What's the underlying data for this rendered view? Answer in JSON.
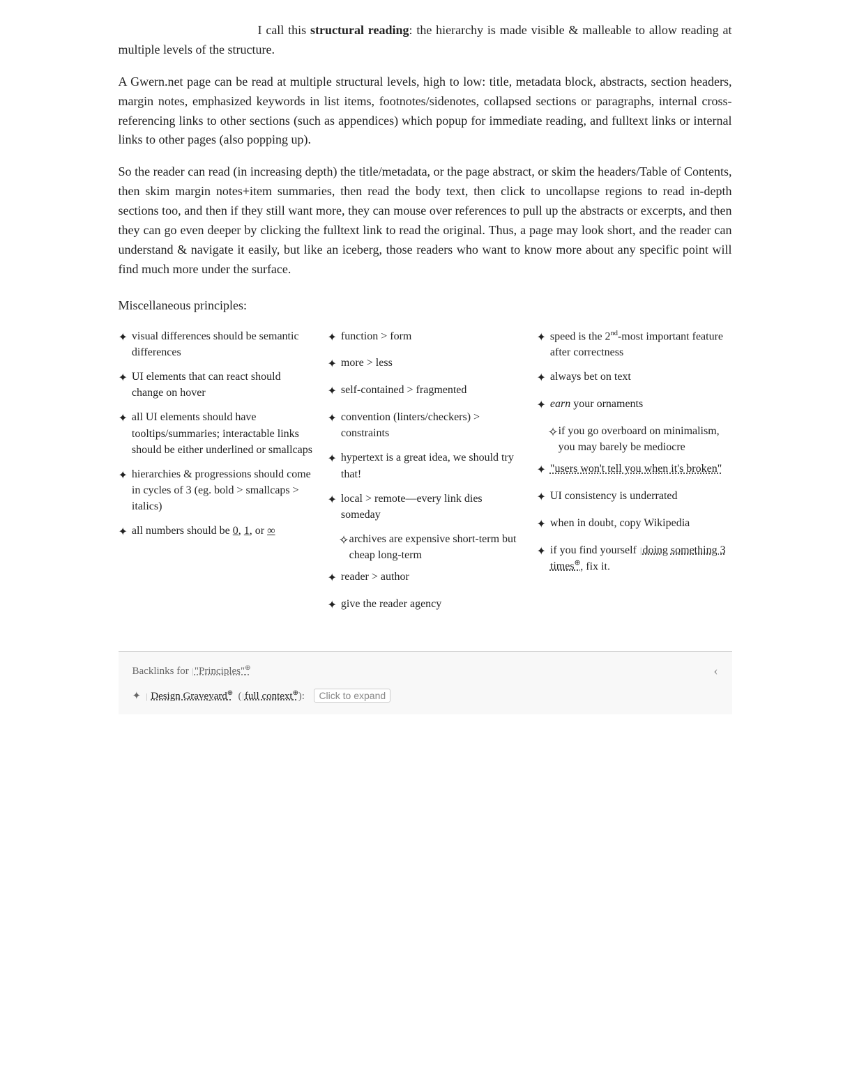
{
  "intro": {
    "p1_prefix": "I call this ",
    "p1_bold": "structural reading",
    "p1_suffix": ": the hierarchy is made visible & malleable to allow reading at multiple levels of the structure.",
    "p2": "A Gwern.net page can be read at multiple structural levels, high to low: title, metadata block, abstracts, section headers, margin notes, emphasized keywords in list items, footnotes/sidenotes, collapsed sections or paragraphs, internal cross-referencing links to other sections (such as appendices) which popup for immediate reading, and fulltext links or internal links to other pages (also popping up).",
    "p3": "So the reader can read (in increasing depth) the title/metadata, or the page abstract, or skim the headers/Table of Contents, then skim margin notes+item summaries, then read the body text, then click to uncollapse regions to read in-depth sections too, and then if they still want more, they can mouse over references to pull up the abstracts or excerpts, and then they can go even deeper by clicking the fulltext link to read the original. Thus, a page may look short, and the reader can understand & navigate it easily, but like an iceberg, those readers who want to know more about any specific point will find much more under the surface.",
    "misc_heading": "Miscellaneous principles:"
  },
  "col1": {
    "items": [
      {
        "text": "visual differences should be semantic differences"
      },
      {
        "text": "UI elements that can react should change on hover"
      },
      {
        "text": "all UI elements should have tooltips/summaries; interactable links should be either underlined or smallcaps"
      },
      {
        "text": "hierarchies & progressions should come in cycles of 3 (eg. bold > smallcaps > italics)"
      },
      {
        "text_parts": [
          "all numbers should be ",
          "0",
          ", ",
          "1",
          ", or ",
          "∞"
        ],
        "has_links": true
      }
    ]
  },
  "col2": {
    "items": [
      {
        "text": "function > form"
      },
      {
        "text": "more > less"
      },
      {
        "text": "self-contained > fragmented"
      },
      {
        "text": "convention (linters/checkers) > constraints"
      },
      {
        "text": "hypertext is a great idea, we should try that!"
      },
      {
        "text": "local > remote—every link dies someday",
        "sub": [
          {
            "text": "archives are expensive short-term but cheap long-term"
          }
        ]
      },
      {
        "text": "reader > author"
      },
      {
        "text": "give the reader agency"
      }
    ]
  },
  "col3": {
    "items": [
      {
        "text_parts": [
          "speed is the 2",
          "nd",
          "-most important feature after correctness"
        ],
        "has_sup": true
      },
      {
        "text": "always bet on text"
      },
      {
        "text_italic": "earn",
        "text_suffix": " your ornaments",
        "sub": [
          {
            "text": "if you go overboard on minimalism, you may barely be mediocre"
          }
        ]
      },
      {
        "text": "“users won’t tell you when it’s broken”",
        "is_link": true
      },
      {
        "text": "UI consistency is underrated"
      },
      {
        "text": "when in doubt, copy Wikipedia"
      },
      {
        "text_parts": [
          "if you find yourself ",
          "doing something 3 times",
          ", fix it."
        ],
        "has_link_part": true
      }
    ]
  },
  "backlinks": {
    "label": "Backlinks for",
    "link_text": "“Principles”",
    "link_sup": "⊕",
    "chevron": "‹",
    "item_prefix": "↳",
    "item_link1": "Design Graveyard",
    "item_link1_sup": "⊕",
    "item_link2": "full context",
    "item_link2_sup": "⊕",
    "item_expand": "Click to expand"
  }
}
